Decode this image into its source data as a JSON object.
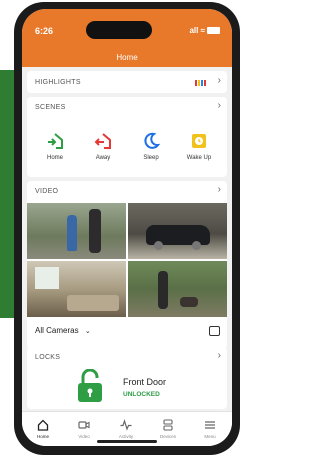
{
  "status_bar": {
    "time": "6:26",
    "signal": "all ≈"
  },
  "header": {
    "title": "Home"
  },
  "highlights": {
    "label": "HIGHLIGHTS"
  },
  "scenes": {
    "label": "SCENES",
    "items": [
      {
        "label": "Home",
        "icon": "home-enter-icon",
        "color": "#2e9d44"
      },
      {
        "label": "Away",
        "icon": "home-exit-icon",
        "color": "#e53935"
      },
      {
        "label": "Sleep",
        "icon": "moon-icon",
        "color": "#1e6ee6"
      },
      {
        "label": "Wake Up",
        "icon": "alarm-clock-icon",
        "color": "#f0c21b"
      }
    ]
  },
  "video": {
    "label": "VIDEO",
    "camera_select": "All Cameras"
  },
  "locks": {
    "label": "LOCKS",
    "lock_name": "Front Door",
    "lock_status": "UNLOCKED",
    "status_color": "#2e9d44"
  },
  "tabbar": {
    "items": [
      {
        "label": "Home",
        "icon": "home-icon",
        "active": true
      },
      {
        "label": "Video",
        "icon": "camera-icon",
        "active": false
      },
      {
        "label": "Activity",
        "icon": "activity-icon",
        "active": false
      },
      {
        "label": "Devices",
        "icon": "devices-icon",
        "active": false
      },
      {
        "label": "Menu",
        "icon": "menu-icon",
        "active": false
      }
    ]
  },
  "colors": {
    "header": "#e8792b",
    "accent_green": "#2e9d44"
  }
}
